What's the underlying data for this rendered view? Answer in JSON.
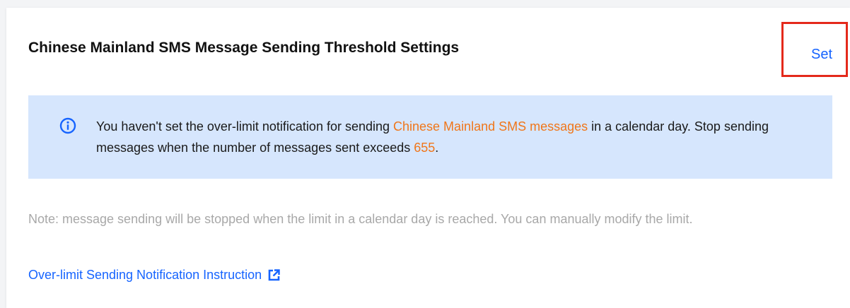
{
  "header": {
    "title": "Chinese Mainland SMS Message Sending Threshold Settings",
    "set_label": "Set"
  },
  "alert": {
    "icon": "info-icon",
    "text_before": "You haven't set the over-limit notification for sending ",
    "highlight_scope": "Chinese Mainland SMS messages",
    "text_middle": " in a calendar day. Stop sending messages when the number of messages sent exceeds ",
    "highlight_limit": "655",
    "text_after": "."
  },
  "note": {
    "text": "Note: message sending will be stopped when the limit in a calendar day is reached. You can manually modify the limit."
  },
  "link": {
    "label": "Over-limit Sending Notification Instruction",
    "icon": "external-link-icon"
  },
  "colors": {
    "accent": "#1664ff",
    "highlight": "#f0761a",
    "alert_background": "#d6e6fd",
    "annotation_box": "#e4291b"
  }
}
